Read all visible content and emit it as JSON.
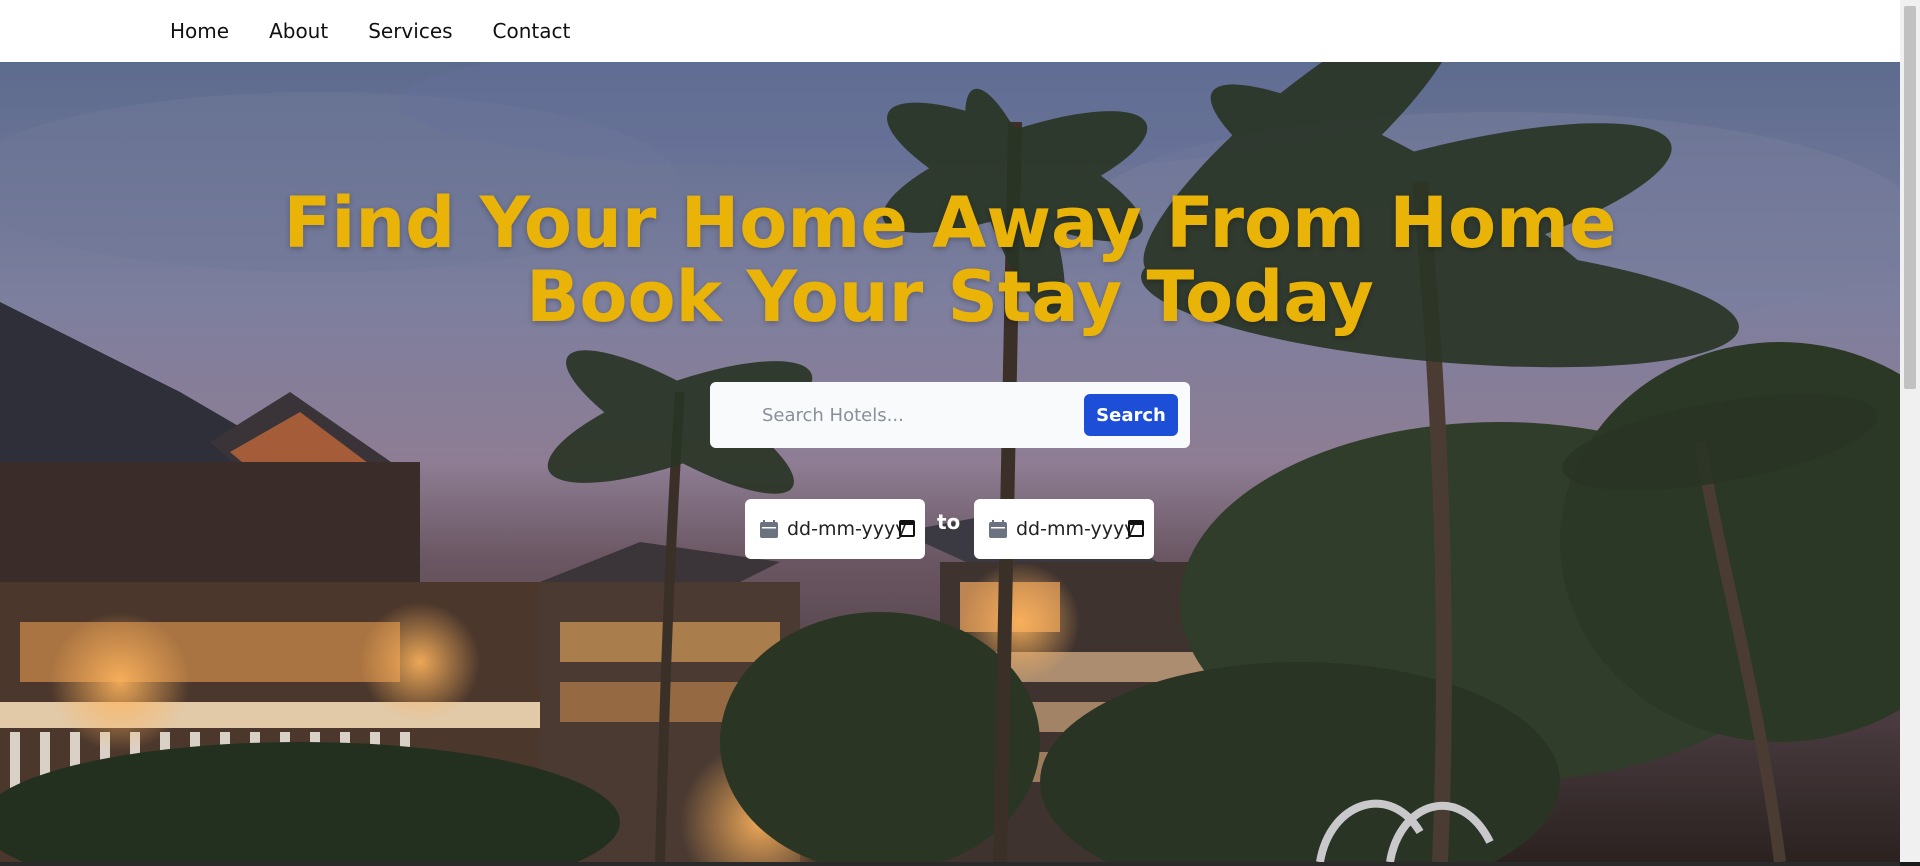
{
  "nav": {
    "items": [
      {
        "label": "Home"
      },
      {
        "label": "About"
      },
      {
        "label": "Services"
      },
      {
        "label": "Contact"
      }
    ]
  },
  "hero": {
    "headline_line1": "Find Your Home Away From Home",
    "headline_line2": "Book Your Stay Today",
    "search": {
      "placeholder": "Search Hotels...",
      "value": "",
      "button_label": "Search"
    },
    "dates": {
      "from_placeholder": "dd-mm-yyyy",
      "separator": "to",
      "to_placeholder": "dd-mm-yyyy"
    }
  },
  "colors": {
    "headline": "#eab308",
    "search_button": "#1d4ed8",
    "nav_background": "#ffffff"
  },
  "icons": {
    "date_field_icon": "calendar-icon",
    "date_picker_icon": "calendar-picker-icon"
  }
}
